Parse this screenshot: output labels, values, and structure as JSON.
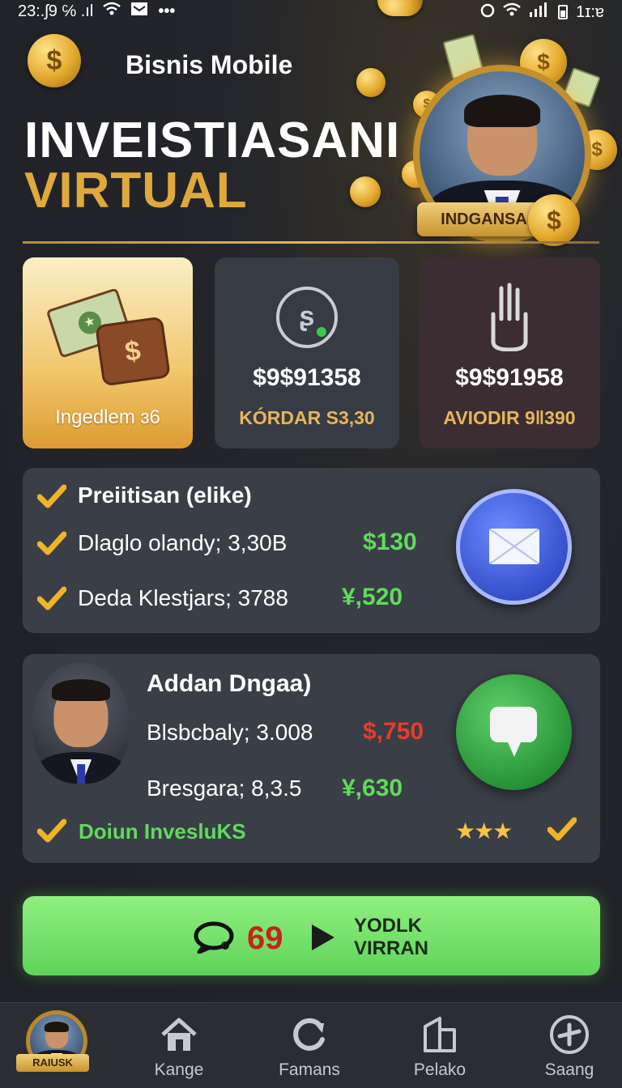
{
  "status_bar": {
    "time_left": "23:.ʃ9 ℅ .ıl",
    "time_right": "1ɪ:ɐ"
  },
  "header": {
    "app_name": "Bisnis Mobile",
    "title_line1": "INVEISTIASANI",
    "title_line2": "VIRTUAL",
    "badge_label": "INDGANSA"
  },
  "stats": [
    {
      "label": "Ingedlem ɜ6",
      "icon": "wallet-money-icon"
    },
    {
      "value": "$9$91358",
      "sub": "KÓRDAR S3,30",
      "icon": "piggy-bank-icon"
    },
    {
      "value": "$9$91958",
      "sub": "AVIODIR 9ǁ390",
      "icon": "hand-icon"
    }
  ],
  "list_card": {
    "heading": "Preiitisan (elike)",
    "rows": [
      {
        "label": "Dlaglo olandy; 3,30B",
        "value": "$130"
      },
      {
        "label": "Deda Klestjars; 3788",
        "value": "¥,520"
      }
    ],
    "action_icon": "mail-icon"
  },
  "profile_card": {
    "name": "Addan Dngaa)",
    "rows": [
      {
        "label": "Blsbcbaly; 3.008",
        "value": "$,750",
        "color": "#ea3b2c"
      },
      {
        "label": "Bresgara; 8,3.5",
        "value": "¥,630",
        "color": "#5fdc5a"
      }
    ],
    "footer": "Doiun InvesluKS",
    "stars": "★★★",
    "action_icon": "chat-bubble-icon"
  },
  "cta": {
    "count": "69",
    "label_line1": "YODLK",
    "label_line2": "VIRRAN"
  },
  "bottom_nav": {
    "profile_tag": "RAIUSK",
    "items": [
      {
        "label": "Kange",
        "icon": "home-icon"
      },
      {
        "label": "Famans",
        "icon": "refresh-icon"
      },
      {
        "label": "Pelako",
        "icon": "building-icon"
      },
      {
        "label": "Saang",
        "icon": "plane-icon"
      }
    ]
  },
  "colors": {
    "accent_gold": "#e0a93b",
    "positive": "#5fdc5a",
    "negative": "#ea3b2c",
    "cta_green": "#6fde64"
  }
}
